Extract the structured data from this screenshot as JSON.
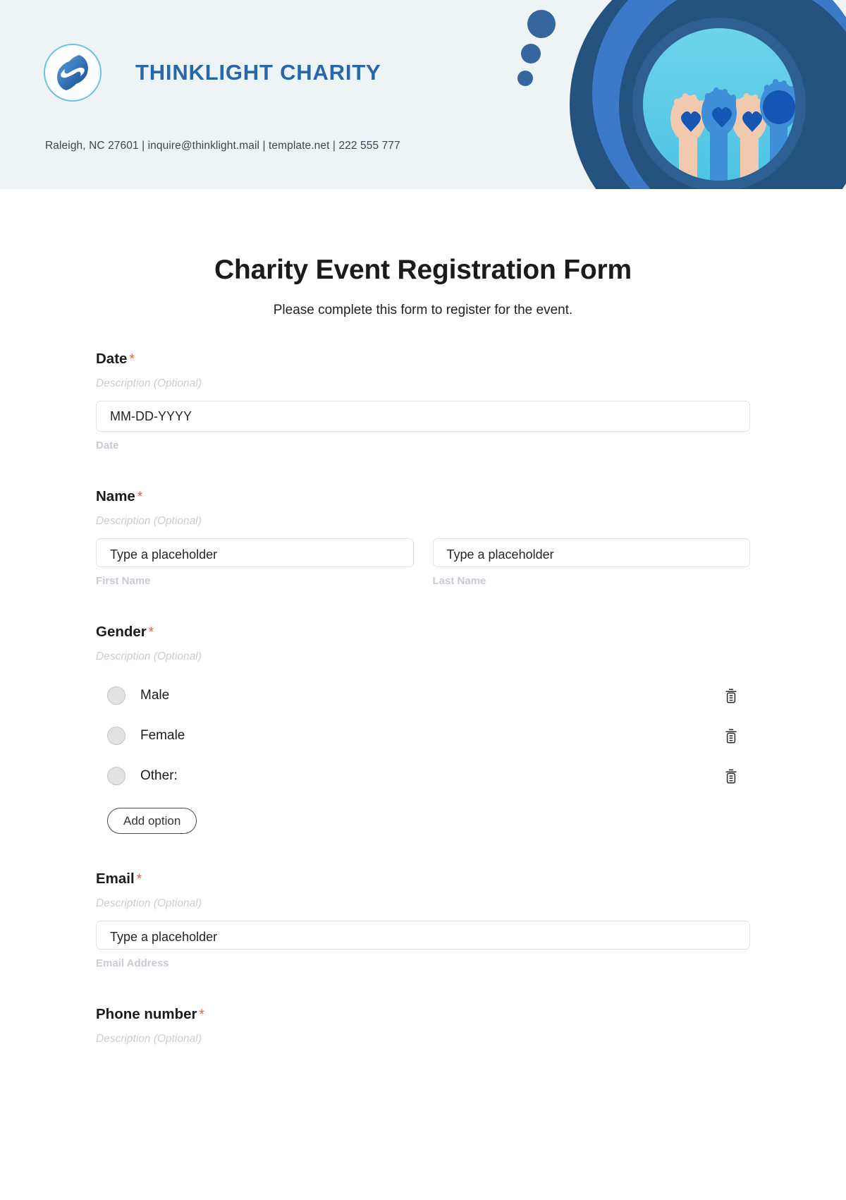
{
  "header": {
    "brand_name": "THINKLIGHT CHARITY",
    "logo_icon": "helping-hands-circle-icon",
    "contact_line": "Raleigh, NC 27601 | inquire@thinklight.mail | template.net | 222 555 777",
    "art_icon": "raised-painted-hands-photo-circle",
    "colors": {
      "band_background": "#eef3f6",
      "brand_blue": "#2767ab",
      "dot_blue": "#36669e",
      "ring_dark": "#24537f",
      "ring_mid": "#3d79c9",
      "photo_bg": "#5ccbe8"
    }
  },
  "form": {
    "title": "Charity Event Registration Form",
    "subtitle": "Please complete this form to register for the event.",
    "required_marker": "*",
    "description_placeholder": "Description (Optional)",
    "add_option_label": "Add option",
    "fields": [
      {
        "label": "Date",
        "description": "Description (Optional)",
        "inputs": [
          {
            "placeholder": "MM-DD-YYYY",
            "sub_label": "Date"
          }
        ]
      },
      {
        "label": "Name",
        "description": "Description (Optional)",
        "inputs": [
          {
            "placeholder": "Type a placeholder",
            "sub_label": "First Name"
          },
          {
            "placeholder": "Type a placeholder",
            "sub_label": "Last Name"
          }
        ]
      },
      {
        "label": "Gender",
        "description": "Description (Optional)",
        "options": [
          {
            "label": "Male",
            "delete_icon": "trash-icon"
          },
          {
            "label": "Female",
            "delete_icon": "trash-icon"
          },
          {
            "label": "Other:",
            "delete_icon": "trash-icon"
          }
        ]
      },
      {
        "label": "Email",
        "description": "Description (Optional)",
        "inputs": [
          {
            "placeholder": "Type a placeholder",
            "sub_label": "Email Address"
          }
        ]
      },
      {
        "label": "Phone number",
        "description": "Description (Optional)"
      }
    ]
  }
}
